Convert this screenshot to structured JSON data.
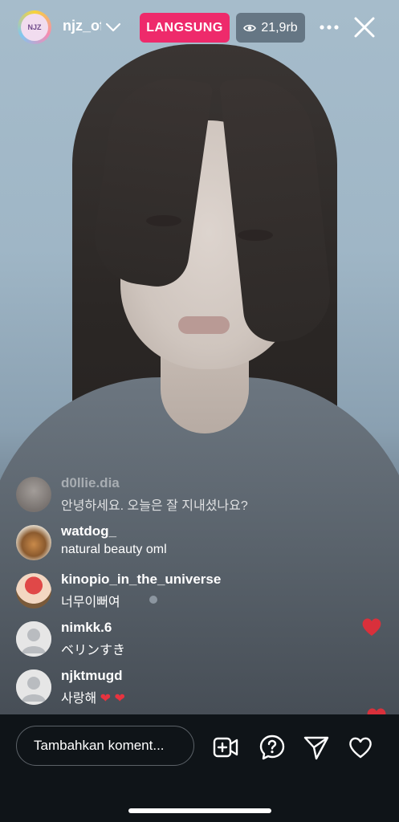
{
  "header": {
    "avatar_text": "NJZ",
    "username": "njz_official",
    "live_label": "LANGSUNG",
    "viewer_count": "21,9rb"
  },
  "comments": [
    {
      "user": "d0llie.dia",
      "text": "안녕하세요. 오늘은 잘 지내셨나요?"
    },
    {
      "user": "watdog_",
      "text": "natural beauty oml"
    },
    {
      "user": "kinopio_in_the_universe",
      "text": "너무이뻐여"
    },
    {
      "user": "nimkk.6",
      "text": "ベリンすき"
    },
    {
      "user": "njktmugd",
      "text": "사랑해"
    }
  ],
  "comment_input": {
    "placeholder": "Tambahkan koment..."
  },
  "colors": {
    "live_badge": "#ee2a6b",
    "heart": "#d9303b"
  },
  "icons": {
    "bottom": [
      "add-video-icon",
      "question-icon",
      "send-icon",
      "heart-icon"
    ],
    "top": [
      "chevron-down-icon",
      "eye-icon",
      "more-icon",
      "close-icon"
    ]
  }
}
